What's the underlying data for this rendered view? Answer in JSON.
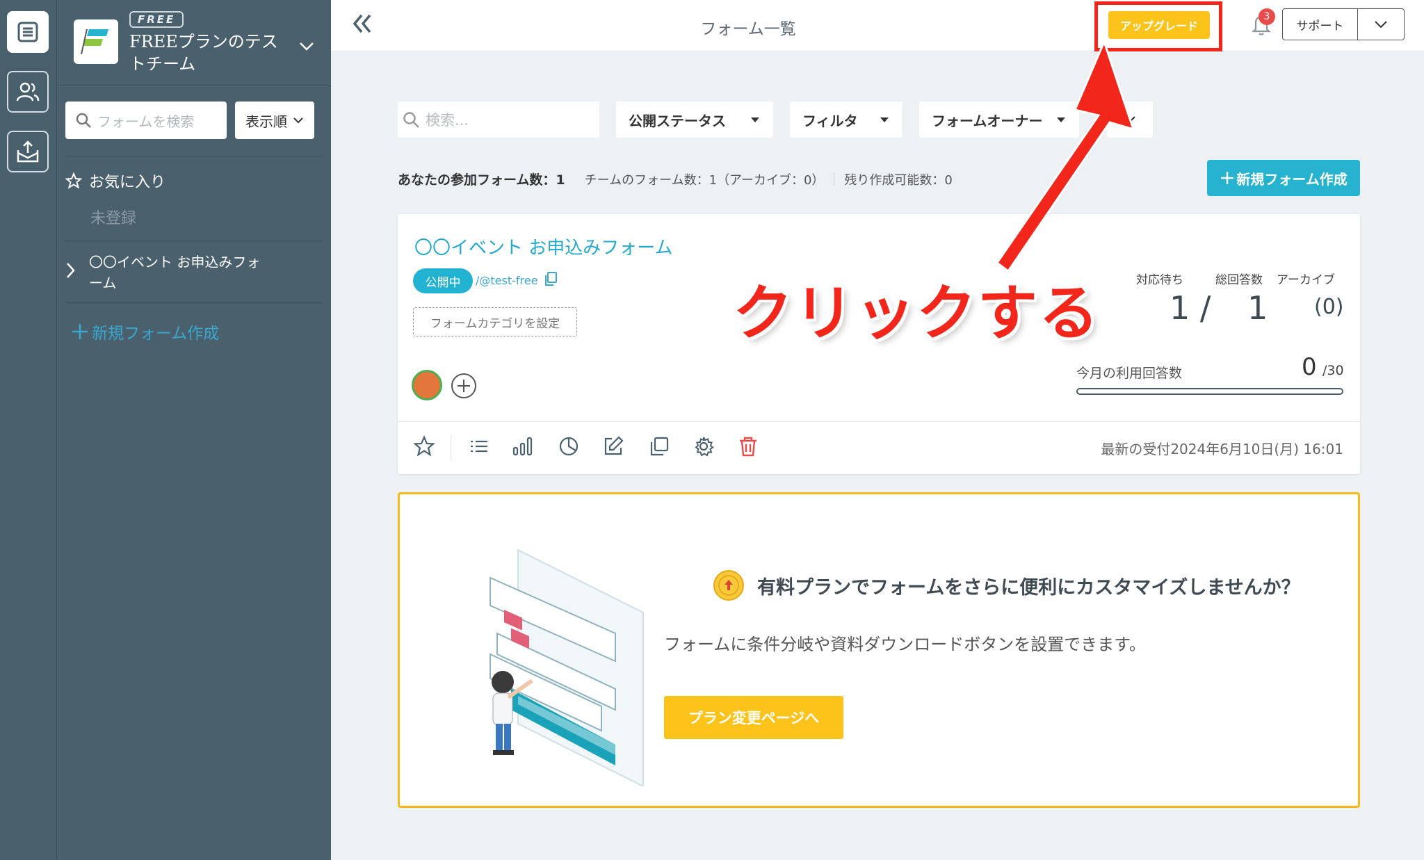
{
  "rail": {
    "items": [
      "forms-list-icon",
      "members-icon",
      "inbox-export-icon"
    ]
  },
  "sidebar": {
    "plan_tag": "FREE",
    "team_name": "FREEプランのテストチーム",
    "search_placeholder": "フォームを検索",
    "sort_label": "表示順",
    "favorites_label": "お気に入り",
    "favorites_empty": "未登録",
    "form_item_label": "〇〇イベント お申込みフォーム",
    "new_form_label": "新規フォーム作成"
  },
  "topbar": {
    "page_title": "フォーム一覧",
    "upgrade_label": "アップグレード",
    "notification_count": "3",
    "support_label": "サポート"
  },
  "filters": {
    "search_placeholder": "検索...",
    "status_label": "公開ステータス",
    "filter_label": "フィルタ",
    "owner_label": "フォームオーナー"
  },
  "stats": {
    "my_forms": "あなたの参加フォーム数：1",
    "team_forms": "チームのフォーム数：1（アーカイブ：0）",
    "remaining": "残り作成可能数：0",
    "new_form_button": "新規フォーム作成"
  },
  "form_card": {
    "title": "〇〇イベント お申込みフォーム",
    "status": "公開中",
    "handle": "/@test-free",
    "category_button": "フォームカテゴリを設定",
    "pending_label": "対応待ち",
    "total_label": "総回答数",
    "archive_label": "アーカイブ",
    "pending_value": "1 /",
    "total_value": "1",
    "archive_value": "(0)",
    "monthly_label": "今月の利用回答数",
    "monthly_value": "0",
    "monthly_max": "/30",
    "monthly_progress": 0,
    "last_received": "最新の受付2024年6月10日(月) 16:01",
    "toolbar_icons": [
      "star-icon",
      "list-icon",
      "bar-chart-icon",
      "pie-chart-icon",
      "edit-icon",
      "duplicate-icon",
      "settings-icon",
      "trash-icon"
    ]
  },
  "promo": {
    "title": "有料プランでフォームをさらに便利にカスタマイズしませんか？",
    "description": "フォームに条件分岐や資料ダウンロードボタンを設置できます。",
    "button": "プラン変更ページへ"
  },
  "annotation": {
    "text": "クリックする",
    "color": "#f2261a"
  },
  "colors": {
    "accent": "#25b3cf",
    "upgrade": "#fcc41a",
    "sidebar": "#4a616d",
    "danger": "#e94b4b"
  }
}
